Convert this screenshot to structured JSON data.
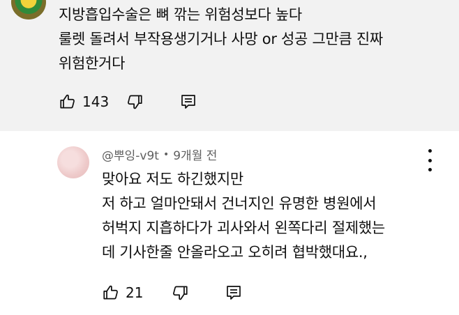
{
  "comments": {
    "top": {
      "lines": [
        "지방흡입수술은 뼈 깎는 위험성보다 높다",
        "룰렛 돌려서 부작용생기거나 사망 or 성공 그만큼 진짜",
        "위험한거다"
      ],
      "likes": "143"
    },
    "reply": {
      "author": "@뿌잉-v9t",
      "separator": "•",
      "time": "9개월 전",
      "lines": [
        "맞아요 저도 하긴했지만",
        "저 하고 얼마안돼서 건너지인 유명한 병원에서",
        "허벅지 지흡하다가 괴사와서 왼쪽다리 절제했는",
        "데 기사한줄 안올라오고 오히려 협박했대요.,"
      ],
      "likes": "21"
    }
  },
  "icons": {
    "like": "thumbs-up-icon",
    "dislike": "thumbs-down-icon",
    "reply": "comment-reply-icon",
    "more": "more-vertical-icon"
  },
  "colors": {
    "top_bg": "#f2f2f2",
    "reply_bg": "#ffffff",
    "text": "#0f0f0f",
    "meta": "#606060"
  }
}
